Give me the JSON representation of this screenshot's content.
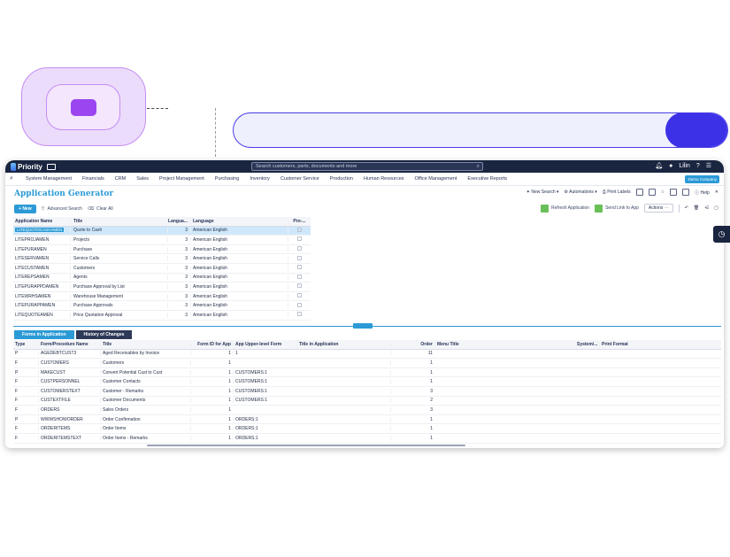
{
  "topbar": {
    "logo_text": "Priority",
    "search_placeholder": "Search customers, parts, documents and more",
    "user": "Lilin"
  },
  "menu": {
    "items": [
      "System Management",
      "Financials",
      "CRM",
      "Sales",
      "Project Management",
      "Purchasing",
      "Inventory",
      "Customer Service",
      "Production",
      "Human Resources",
      "Office Management",
      "Executive Reports"
    ],
    "demo_badge": "Demo Company"
  },
  "title": {
    "text": "Application Generator",
    "new_search": "New Search",
    "automations": "Automations",
    "print_labels": "Print Labels",
    "help": "Help"
  },
  "toolbar": {
    "new_label": "New",
    "advanced_search": "Advanced Search",
    "clear_all": "Clear All",
    "refresh_application": "Refresh Application",
    "send_link": "Send Link to App",
    "actions": "Actions"
  },
  "top_grid": {
    "headers": [
      "Application Name",
      "Title",
      "Langua...",
      "Language",
      "Pro-..."
    ],
    "rows": [
      [
        "LITEQUOTOCASHAMEN",
        "Quote to Cash",
        "3",
        "American English"
      ],
      [
        "LITEPROJAMEN",
        "Projects",
        "3",
        "American English"
      ],
      [
        "LITEPURAMEN",
        "Purchase",
        "3",
        "American English"
      ],
      [
        "LITESERVAMEN",
        "Service Calls",
        "3",
        "American English"
      ],
      [
        "LITECUSTAMEN",
        "Customers",
        "3",
        "American English"
      ],
      [
        "LITEREPSAMEN",
        "Agents",
        "3",
        "American English"
      ],
      [
        "LITEPURAPPDAMEN",
        "Purchase Approval by List",
        "3",
        "American English"
      ],
      [
        "LITEWRHSAMEN",
        "Warehouse Management",
        "3",
        "American English"
      ],
      [
        "LITEPURAPPAMEN",
        "Purchase Approvals",
        "3",
        "American English"
      ],
      [
        "LITEQUOTEAMEN",
        "Price Quotation Approval",
        "3",
        "American English"
      ]
    ]
  },
  "tabs": [
    "Forms in Application",
    "History of Changes"
  ],
  "bottom_grid": {
    "headers": [
      "Type",
      "Form/Procedure Name",
      "Title",
      "Form ID for App",
      "App Upper-level Form",
      "Title in Application",
      "Order",
      "Menu Title",
      "System/...",
      "Print Format"
    ],
    "rows": [
      [
        "P",
        "AGEDEBTCUST3",
        "Aged Receivables by Invoice",
        "1",
        "1",
        "",
        "11"
      ],
      [
        "F",
        "CUSTOMERS",
        "Customers",
        "1",
        "",
        "",
        "1"
      ],
      [
        "P",
        "MAKECUST",
        "Convert Potential Cust to Cust",
        "1",
        "CUSTOMERS:1",
        "",
        "1"
      ],
      [
        "F",
        "CUSTPERSONNEL",
        "Customer Contacts",
        "1",
        "CUSTOMERS:1",
        "",
        "1"
      ],
      [
        "F",
        "CUSTOMERSTEXT",
        "Customer - Remarks",
        "1",
        "CUSTOMERS:1",
        "",
        "3"
      ],
      [
        "F",
        "CUSTEXTFILE",
        "Customer Documents",
        "1",
        "CUSTOMERS:1",
        "",
        "2"
      ],
      [
        "F",
        "ORDERS",
        "Sales Orders",
        "1",
        "",
        "",
        "3"
      ],
      [
        "P",
        "WWWSHOWORDER",
        "Order Confirmation",
        "1",
        "ORDERS:1",
        "",
        "1"
      ],
      [
        "F",
        "ORDERITEMS",
        "Order Items",
        "1",
        "ORDERS:1",
        "",
        "1"
      ],
      [
        "F",
        "ORDERITEMSTEXT",
        "Order Items - Remarks",
        "1",
        "ORDERS:1",
        "",
        "1"
      ]
    ]
  },
  "colors": {
    "accent": "#2b9ad6",
    "dark": "#1a2540",
    "purple": "#9b45f0",
    "indigo": "#3d31e8"
  }
}
